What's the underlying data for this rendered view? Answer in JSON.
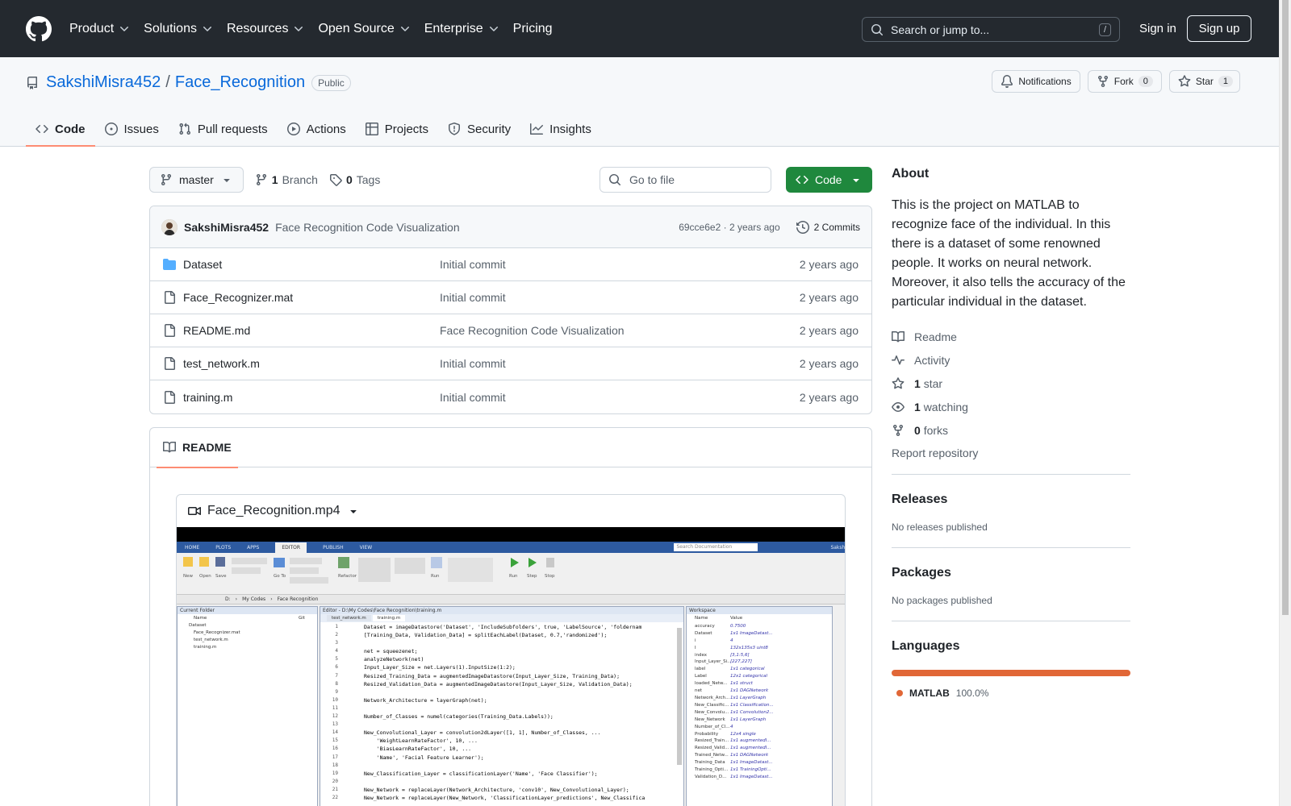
{
  "header": {
    "nav": [
      {
        "label": "Product",
        "has_menu": true
      },
      {
        "label": "Solutions",
        "has_menu": true
      },
      {
        "label": "Resources",
        "has_menu": true
      },
      {
        "label": "Open Source",
        "has_menu": true
      },
      {
        "label": "Enterprise",
        "has_menu": true
      },
      {
        "label": "Pricing",
        "has_menu": false
      }
    ],
    "search_placeholder": "Search or jump to...",
    "search_shortcut": "/",
    "sign_in": "Sign in",
    "sign_up": "Sign up"
  },
  "repo": {
    "owner": "SakshiMisra452",
    "separator": "/",
    "name": "Face_Recognition",
    "visibility": "Public",
    "notifications_label": "Notifications",
    "fork_label": "Fork",
    "fork_count": "0",
    "star_label": "Star",
    "star_count": "1",
    "tabs": [
      {
        "label": "Code",
        "icon": "code-icon",
        "active": true
      },
      {
        "label": "Issues",
        "icon": "issue-icon",
        "active": false
      },
      {
        "label": "Pull requests",
        "icon": "pull-request-icon",
        "active": false
      },
      {
        "label": "Actions",
        "icon": "play-icon",
        "active": false
      },
      {
        "label": "Projects",
        "icon": "table-icon",
        "active": false
      },
      {
        "label": "Security",
        "icon": "shield-icon",
        "active": false
      },
      {
        "label": "Insights",
        "icon": "graph-icon",
        "active": false
      }
    ]
  },
  "toolbar": {
    "branch": "master",
    "branch_count": "1",
    "branch_label": "Branch",
    "tag_count": "0",
    "tag_label": "Tags",
    "goto_placeholder": "Go to file",
    "code_label": "Code"
  },
  "latest_commit": {
    "author": "SakshiMisra452",
    "message": "Face Recognition Code Visualization",
    "hash": "69cce6e2",
    "separator": "·",
    "age": "2 years ago",
    "commits_label": "2 Commits"
  },
  "files": [
    {
      "name": "Dataset",
      "type": "folder",
      "message": "Initial commit",
      "age": "2 years ago"
    },
    {
      "name": "Face_Recognizer.mat",
      "type": "file",
      "message": "Initial commit",
      "age": "2 years ago"
    },
    {
      "name": "README.md",
      "type": "file",
      "message": "Face Recognition Code Visualization",
      "age": "2 years ago"
    },
    {
      "name": "test_network.m",
      "type": "file",
      "message": "Initial commit",
      "age": "2 years ago"
    },
    {
      "name": "training.m",
      "type": "file",
      "message": "Initial commit",
      "age": "2 years ago"
    }
  ],
  "readme": {
    "tab_label": "README",
    "video_name": "Face_Recognition.mp4"
  },
  "matlab": {
    "tabs": [
      "HOME",
      "PLOTS",
      "APPS",
      "EDITOR",
      "PUBLISH",
      "VIEW"
    ],
    "active_tab": "EDITOR",
    "search_placeholder": "Search Documentation",
    "user": "Sakshi",
    "path": [
      "D:",
      "My Codes",
      "Face Recognition"
    ],
    "current_folder_title": "Current Folder",
    "editor_title": "Editor - D:\\My Codes\\Face Recognition\\training.m",
    "editor_tabs": [
      "test_network.m",
      "training.m"
    ],
    "workspace_title": "Workspace",
    "folder_columns": [
      "Name",
      "Git"
    ],
    "folder_items": [
      "Dataset",
      "Face_Recognizer.mat",
      "test_network.m",
      "training.m"
    ],
    "workspace_columns": [
      "Name",
      "Value"
    ],
    "workspace": [
      [
        "accuracy",
        "0.7500"
      ],
      [
        "Dataset",
        "1x1 ImageDatast..."
      ],
      [
        "i",
        "4"
      ],
      [
        "I",
        "132x135x3 uint8"
      ],
      [
        "index",
        "[3,1:5,6]"
      ],
      [
        "Input_Layer_Si...",
        "[227,227]"
      ],
      [
        "label",
        "1x1 categorical"
      ],
      [
        "Label",
        "12x1 categorical"
      ],
      [
        "loaded_Netw...",
        "1x1 struct"
      ],
      [
        "net",
        "1x1 DAGNetwork"
      ],
      [
        "Network_Arch...",
        "1x1 LayerGraph"
      ],
      [
        "New_Classific...",
        "1x1 Classification..."
      ],
      [
        "New_Convolu...",
        "1x1 Convolution2..."
      ],
      [
        "New_Network",
        "1x1 LayerGraph"
      ],
      [
        "Number_of_Cl...",
        "4"
      ],
      [
        "Probability",
        "12x4 single"
      ],
      [
        "Resized_Train...",
        "1x1 augmentedI..."
      ],
      [
        "Resized_Valid...",
        "1x1 augmentedI..."
      ],
      [
        "Trained_Netw...",
        "1x1 DAGNetwork"
      ],
      [
        "Training_Data",
        "1x1 ImageDatast..."
      ],
      [
        "Training_Opti...",
        "1x1 TrainingOpti..."
      ],
      [
        "Validation_D...",
        "1x1 ImageDatast..."
      ]
    ],
    "code_lines": [
      "Dataset = imageDatastore('Dataset', 'IncludeSubfolders', true, 'LabelSource', 'foldernam",
      "[Training_Data, Validation_Data] = splitEachLabel(Dataset, 0.7,'randomized');",
      "",
      "net = squeezenet;",
      "analyzeNetwork(net)",
      "Input_Layer_Size = net.Layers(1).InputSize(1:2);",
      "Resized_Training_Data = augmentedImageDatastore(Input_Layer_Size, Training_Data);",
      "Resized_Validation_Data = augmentedImageDatastore(Input_Layer_Size, Validation_Data);",
      "",
      "Network_Architecture = layerGraph(net);",
      "",
      "Number_of_Classes = numel(categories(Training_Data.Labels));",
      "",
      "New_Convolutional_Layer = convolution2dLayer([1, 1], Number_of_Classes, ...",
      "    'WeightLearnRateFactor', 10, ...",
      "    'BiasLearnRateFactor', 10, ...",
      "    'Name', 'Facial Feature Learner');",
      "",
      "New_Classification_Layer = classificationLayer('Name', 'Face Classifier');",
      "",
      "New_Network = replaceLayer(Network_Architecture, 'conv10', New_Convolutional_Layer);",
      "New_Network = replaceLayer(New_Network, 'ClassificationLayer_predictions', New_Classifica"
    ]
  },
  "about": {
    "title": "About",
    "description": "This is the project on MATLAB to recognize face of the individual. In this there is a dataset of some renowned people. It works on neural network. Moreover, it also tells the accuracy of the particular individual in the dataset.",
    "links": [
      {
        "icon": "book-icon",
        "count": "",
        "label": "Readme"
      },
      {
        "icon": "pulse-icon",
        "count": "",
        "label": "Activity"
      },
      {
        "icon": "star-icon",
        "count": "1",
        "label": "star"
      },
      {
        "icon": "eye-icon",
        "count": "1",
        "label": "watching"
      },
      {
        "icon": "fork-icon",
        "count": "0",
        "label": "forks"
      }
    ],
    "report": "Report repository"
  },
  "releases": {
    "title": "Releases",
    "text": "No releases published"
  },
  "packages": {
    "title": "Packages",
    "text": "No packages published"
  },
  "languages": {
    "title": "Languages",
    "items": [
      {
        "name": "MATLAB",
        "percent": "100.0%",
        "color": "#e16737"
      }
    ]
  },
  "colors": {
    "header_bg": "#24292f",
    "code_button": "#1f883d",
    "link": "#0969da",
    "tab_underline": "#fd8c73"
  }
}
